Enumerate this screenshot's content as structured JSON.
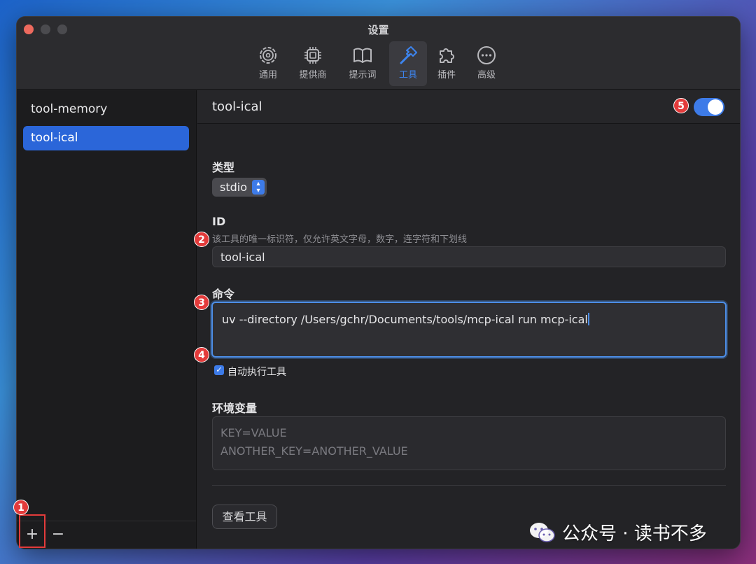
{
  "window": {
    "title": "设置"
  },
  "toolbar": {
    "items": [
      {
        "label": "通用",
        "icon": "gear-icon"
      },
      {
        "label": "提供商",
        "icon": "chip-icon"
      },
      {
        "label": "提示词",
        "icon": "book-icon"
      },
      {
        "label": "工具",
        "icon": "hammer-icon"
      },
      {
        "label": "插件",
        "icon": "puzzle-icon"
      },
      {
        "label": "高级",
        "icon": "ellipsis-circle-icon"
      }
    ],
    "active": "工具",
    "accent": "#3d85f0"
  },
  "sidebar": {
    "items": [
      {
        "label": "tool-memory"
      },
      {
        "label": "tool-ical"
      }
    ],
    "selected": "tool-ical",
    "add_label": "+",
    "remove_label": "−"
  },
  "main": {
    "title": "tool-ical",
    "enabled": true,
    "type": {
      "label": "类型",
      "value": "stdio"
    },
    "id": {
      "label": "ID",
      "help": "该工具的唯一标识符，仅允许英文字母，数字，连字符和下划线",
      "value": "tool-ical"
    },
    "command": {
      "label": "命令",
      "value": "uv --directory /Users/gchr/Documents/tools/mcp-ical run mcp-ical"
    },
    "auto_execute": {
      "label": "自动执行工具",
      "checked": true
    },
    "env": {
      "label": "环境变量",
      "placeholder_line1": "KEY=VALUE",
      "placeholder_line2": "ANOTHER_KEY=ANOTHER_VALUE"
    },
    "view_tools_label": "查看工具"
  },
  "annotations": {
    "badge1": "1",
    "badge2": "2",
    "badge3": "3",
    "badge4": "4",
    "badge5": "5",
    "color": "#e33b3b"
  },
  "watermark": {
    "text": "公众号 · 读书不多"
  }
}
